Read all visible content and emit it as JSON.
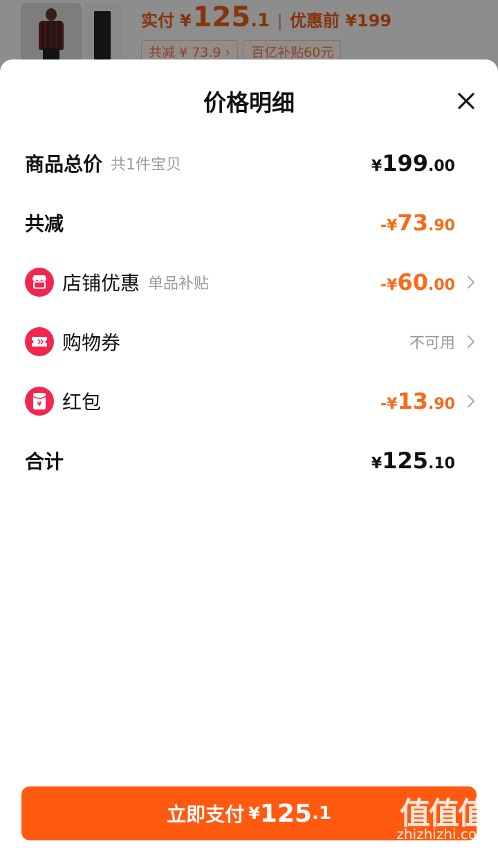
{
  "background": {
    "paid_label": "实付",
    "paid_currency": "¥",
    "paid_int": "125",
    "paid_dec": ".1",
    "separator": "|",
    "before_discount": "优惠前 ¥199",
    "tags": [
      "共减 ¥ 73.9 ›",
      "百亿补贴60元"
    ]
  },
  "sheet": {
    "title": "价格明细",
    "close_icon": "close-icon"
  },
  "rows": {
    "total": {
      "label": "商品总价",
      "sub": "共1件宝贝",
      "currency": "¥",
      "int": "199",
      "dec": ".00"
    },
    "reduce": {
      "label": "共减",
      "currency": "-¥",
      "int": "73",
      "dec": ".90"
    },
    "shop": {
      "icon": "store-icon",
      "label": "店铺优惠",
      "sub": "单品补贴",
      "currency": "-¥",
      "int": "60",
      "dec": ".00"
    },
    "coupon": {
      "icon": "ticket-icon",
      "label": "购物券",
      "value": "不可用"
    },
    "redpacket": {
      "icon": "red-packet-icon",
      "label": "红包",
      "currency": "-¥",
      "int": "13",
      "dec": ".90"
    },
    "sum": {
      "label": "合计",
      "currency": "¥",
      "int": "125",
      "dec": ".10"
    }
  },
  "pay_button": {
    "label": "立即支付",
    "currency": "¥",
    "int": "125",
    "dec": ".1"
  },
  "watermark": {
    "big": "值值值",
    "small": "zhizhizhi.com"
  },
  "colors": {
    "accent": "#ff5a0f",
    "discount": "#f56b1a",
    "icon_red": "#f02850"
  }
}
